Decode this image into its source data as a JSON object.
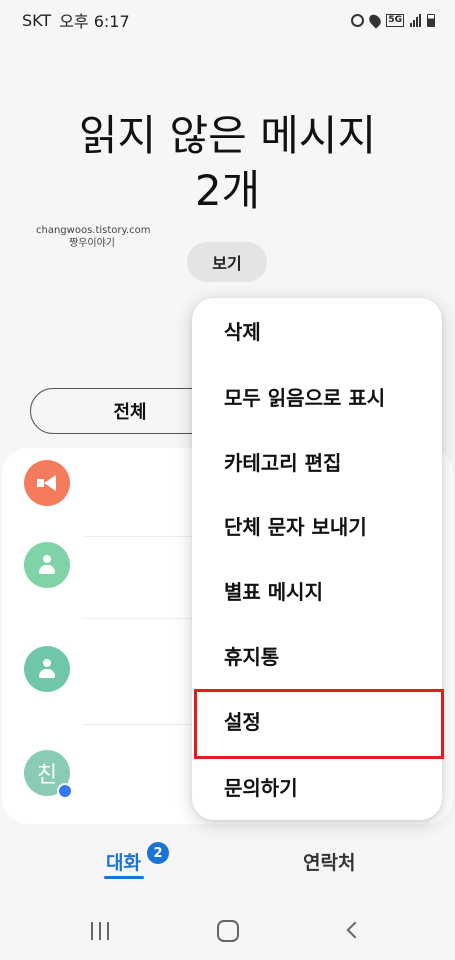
{
  "status_bar": {
    "carrier": "SKT",
    "time": "오후 6:17",
    "network_label": "5G",
    "icons": [
      "alarm-icon",
      "location-icon",
      "5g-icon",
      "signal-icon",
      "battery-icon"
    ]
  },
  "header": {
    "title_line1": "읽지 않은 메시지",
    "title_line2": "2개",
    "view_button": "보기"
  },
  "watermark": {
    "line1": "changwoos.tistory.com",
    "line2": "짱우이야기"
  },
  "filter": {
    "all_label": "전체"
  },
  "conversations": [
    {
      "avatar": "megaphone-icon",
      "color": "#f47c5c"
    },
    {
      "avatar": "person-icon",
      "color": "#7fd3a6"
    },
    {
      "avatar": "person-icon",
      "color": "#6fc7a8"
    },
    {
      "avatar": "text",
      "initial": "친",
      "color": "#89cbb4"
    }
  ],
  "menu": {
    "items": [
      "삭제",
      "모두 읽음으로 표시",
      "카테고리 편집",
      "단체 문자 보내기",
      "별표 메시지",
      "휴지통",
      "설정",
      "문의하기"
    ],
    "highlighted_index": 6,
    "highlight_color": "#e21b1b"
  },
  "tabs": {
    "conversations_label": "대화",
    "conversations_badge": "2",
    "contacts_label": "연락처",
    "accent_color": "#1a73d9"
  }
}
